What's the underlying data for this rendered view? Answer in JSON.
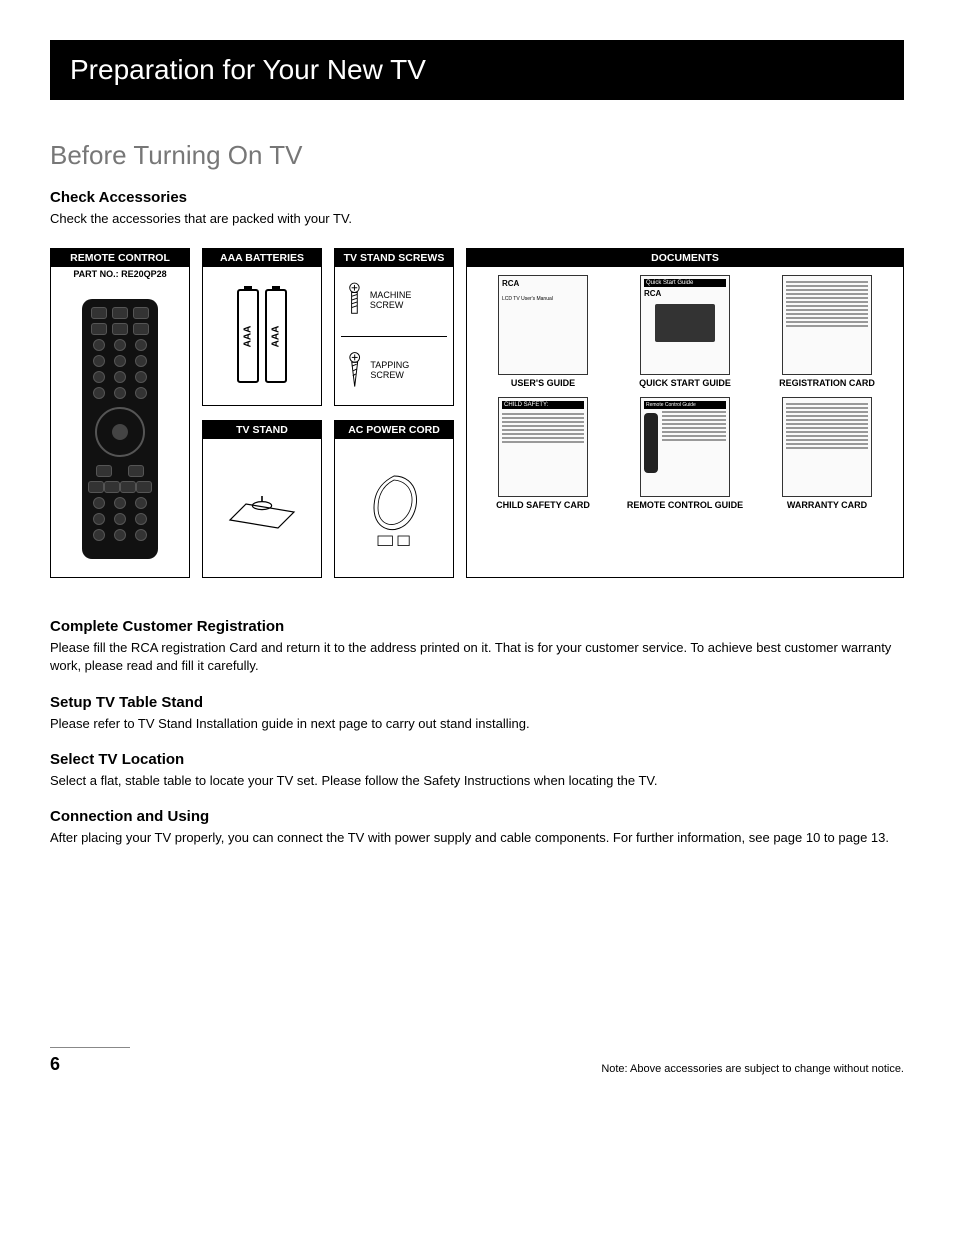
{
  "title_bar": "Preparation for Your New TV",
  "section_title": "Before Turning On TV",
  "check": {
    "heading": "Check Accessories",
    "text": "Check the accessories that are packed with your TV."
  },
  "accessories": {
    "remote": {
      "header": "REMOTE CONTROL",
      "part_no": "PART NO.: RE20QP28"
    },
    "batteries": {
      "header": "AAA BATTERIES",
      "label": "AAA"
    },
    "tv_stand": {
      "header": "TV STAND"
    },
    "screws": {
      "header": "TV STAND SCREWS",
      "machine": "MACHINE SCREW",
      "tapping": "TAPPING SCREW"
    },
    "power_cord": {
      "header": "AC POWER CORD"
    },
    "documents": {
      "header": "DOCUMENTS",
      "items": [
        {
          "label": "USER'S GUIDE",
          "thumb_title": "RCA",
          "thumb_sub": "LCD TV User's Manual"
        },
        {
          "label": "QUICK START GUIDE",
          "thumb_title": "Quick Start Guide",
          "thumb_sub": "RCA"
        },
        {
          "label": "REGISTRATION CARD",
          "thumb_title": "",
          "thumb_sub": ""
        },
        {
          "label": "CHILD SAFETY CARD",
          "thumb_title": "CHILD SAFETY:",
          "thumb_sub": ""
        },
        {
          "label": "REMOTE CONTROL GUIDE",
          "thumb_title": "Remote Control Guide",
          "thumb_sub": ""
        },
        {
          "label": "WARRANTY CARD",
          "thumb_title": "",
          "thumb_sub": ""
        }
      ]
    }
  },
  "sections": [
    {
      "heading": "Complete Customer Registration",
      "text": "Please fill the RCA registration Card and return it to the address printed on it. That is for your customer service. To achieve best customer warranty work, please read and fill it carefully."
    },
    {
      "heading": "Setup TV Table Stand",
      "text": "Please refer to TV Stand Installation guide in next page to carry out stand installing."
    },
    {
      "heading": "Select TV Location",
      "text": "Select a flat, stable table to locate your TV set. Please follow the Safety Instructions when locating the TV."
    },
    {
      "heading": "Connection and Using",
      "text": "After placing your TV properly, you can connect the TV with power supply and cable components. For further information, see page 10 to page 13."
    }
  ],
  "footer": {
    "page_number": "6",
    "note": "Note: Above accessories are subject to change without notice."
  }
}
